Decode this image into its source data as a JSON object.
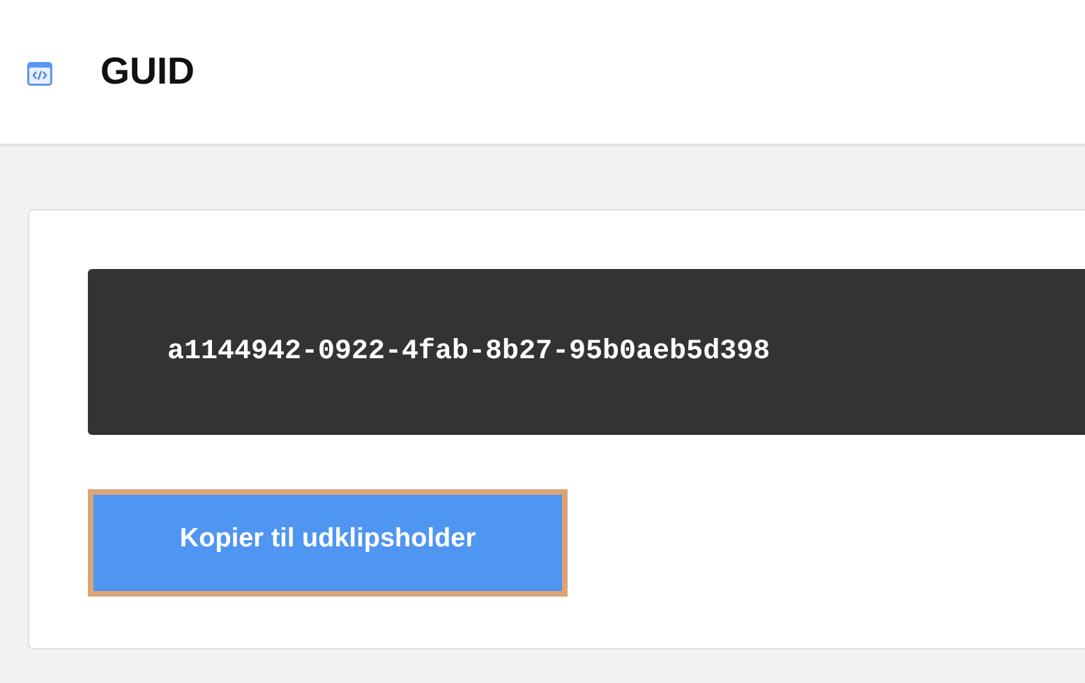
{
  "header": {
    "title": "GUID"
  },
  "guid": {
    "value": "a1144942-0922-4fab-8b27-95b0aeb5d398"
  },
  "copy_button": {
    "label": "Kopier til udklipsholder",
    "focused": true
  }
}
